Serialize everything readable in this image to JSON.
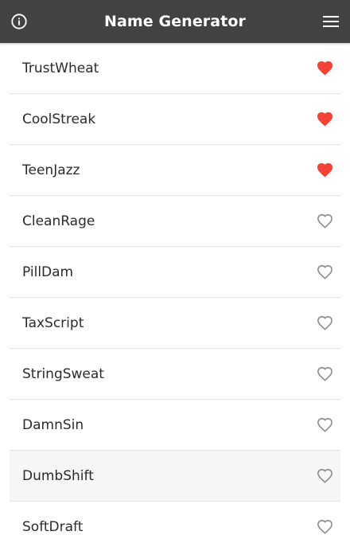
{
  "app": {
    "title": "Name Generator",
    "bar_color": "#424242",
    "left_icon": "info-icon",
    "right_icon": "menu-icon"
  },
  "colors": {
    "favorite": "#f44336",
    "not_favorite": "#8a8a8a"
  },
  "names": [
    {
      "label": "TrustWheat",
      "favorited": true
    },
    {
      "label": "CoolStreak",
      "favorited": true
    },
    {
      "label": "TeenJazz",
      "favorited": true
    },
    {
      "label": "CleanRage",
      "favorited": false
    },
    {
      "label": "PillDam",
      "favorited": false
    },
    {
      "label": "TaxScript",
      "favorited": false
    },
    {
      "label": "StringSweat",
      "favorited": false
    },
    {
      "label": "DamnSin",
      "favorited": false
    },
    {
      "label": "DumbShift",
      "favorited": false
    },
    {
      "label": "SoftDraft",
      "favorited": false
    }
  ]
}
